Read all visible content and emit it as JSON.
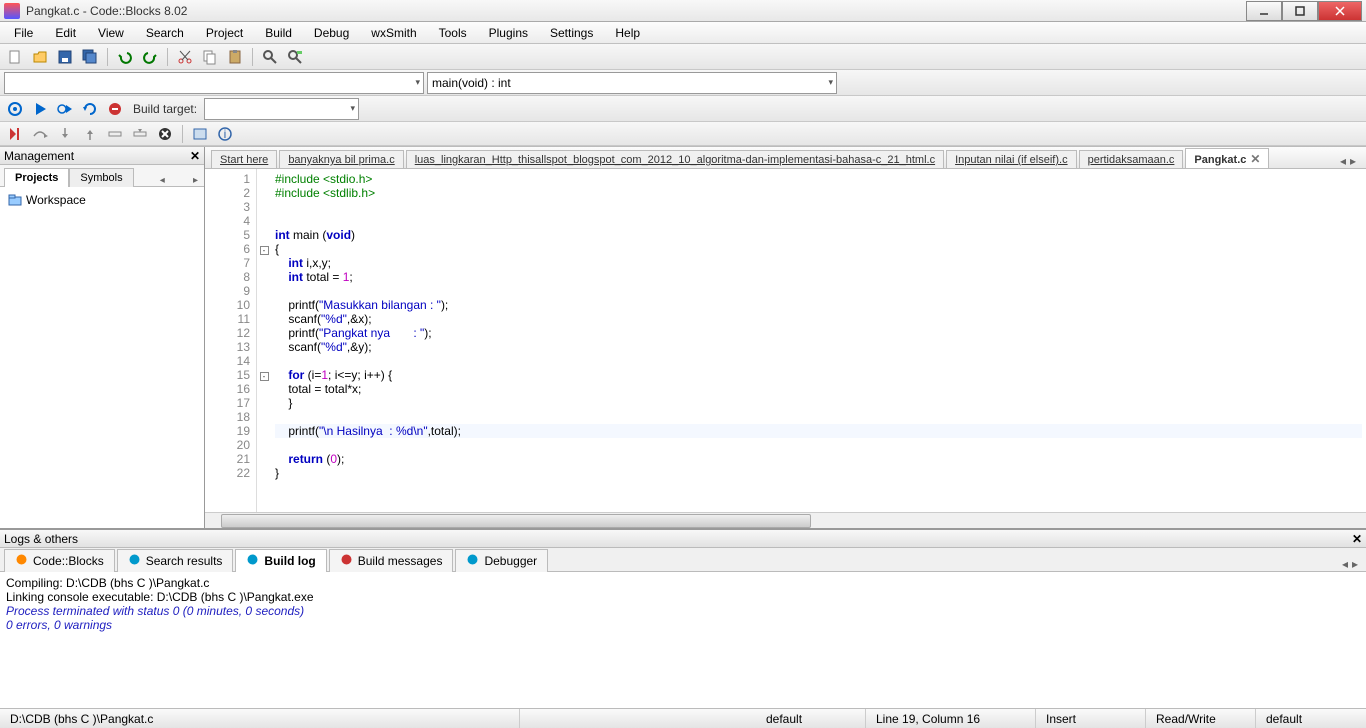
{
  "window": {
    "title": "Pangkat.c - Code::Blocks 8.02"
  },
  "menu": [
    "File",
    "Edit",
    "View",
    "Search",
    "Project",
    "Build",
    "Debug",
    "wxSmith",
    "Tools",
    "Plugins",
    "Settings",
    "Help"
  ],
  "combo_func": "main(void) : int",
  "build_target_label": "Build target:",
  "mgmt": {
    "title": "Management",
    "tabs": [
      "Projects",
      "Symbols"
    ],
    "active_tab": 0,
    "tree_root": "Workspace"
  },
  "editor": {
    "tabs": [
      {
        "label": "Start here",
        "active": false,
        "close": false
      },
      {
        "label": "banyaknya bil prima.c",
        "active": false,
        "close": false
      },
      {
        "label": "luas_lingkaran_Http_thisallspot_blogspot_com_2012_10_algoritma-dan-implementasi-bahasa-c_21_html.c",
        "active": false,
        "close": false
      },
      {
        "label": "Inputan nilai (if elseif).c",
        "active": false,
        "close": false
      },
      {
        "label": "pertidaksamaan.c",
        "active": false,
        "close": false
      },
      {
        "label": "Pangkat.c",
        "active": true,
        "close": true
      }
    ],
    "code": [
      {
        "n": 1,
        "fold": "",
        "html": "<span class='kw-pp'>#include &lt;stdio.h&gt;</span>"
      },
      {
        "n": 2,
        "fold": "",
        "html": "<span class='kw-pp'>#include &lt;stdlib.h&gt;</span>"
      },
      {
        "n": 3,
        "fold": "",
        "html": ""
      },
      {
        "n": 4,
        "fold": "",
        "html": ""
      },
      {
        "n": 5,
        "fold": "",
        "html": "<span class='kw'>int</span> main (<span class='kw'>void</span>)"
      },
      {
        "n": 6,
        "fold": "-",
        "html": "{"
      },
      {
        "n": 7,
        "fold": "",
        "html": "    <span class='kw'>int</span> i,x,y;"
      },
      {
        "n": 8,
        "fold": "",
        "html": "    <span class='kw'>int</span> total = <span class='num'>1</span>;"
      },
      {
        "n": 9,
        "fold": "",
        "html": ""
      },
      {
        "n": 10,
        "fold": "",
        "html": "    printf(<span class='str'>\"Masukkan bilangan : \"</span>);"
      },
      {
        "n": 11,
        "fold": "",
        "html": "    scanf(<span class='str'>\"%d\"</span>,&amp;x);"
      },
      {
        "n": 12,
        "fold": "",
        "html": "    printf(<span class='str'>\"Pangkat nya       : \"</span>);"
      },
      {
        "n": 13,
        "fold": "",
        "html": "    scanf(<span class='str'>\"%d\"</span>,&amp;y);"
      },
      {
        "n": 14,
        "fold": "",
        "html": ""
      },
      {
        "n": 15,
        "fold": "-",
        "html": "    <span class='kw'>for</span> (i=<span class='num'>1</span>; i&lt;=y; i++) {"
      },
      {
        "n": 16,
        "fold": "",
        "html": "    total = total*x;"
      },
      {
        "n": 17,
        "fold": "",
        "html": "    }"
      },
      {
        "n": 18,
        "fold": "",
        "html": ""
      },
      {
        "n": 19,
        "fold": "",
        "html": "    printf(<span class='str'>\"\\n Hasilnya  : %d\\n\"</span>,total);",
        "cursor": true
      },
      {
        "n": 20,
        "fold": "",
        "html": ""
      },
      {
        "n": 21,
        "fold": "",
        "html": "    <span class='kw'>return</span> (<span class='num'>0</span>);"
      },
      {
        "n": 22,
        "fold": "",
        "html": "}"
      }
    ]
  },
  "logs": {
    "title": "Logs & others",
    "tabs": [
      "Code::Blocks",
      "Search results",
      "Build log",
      "Build messages",
      "Debugger"
    ],
    "active": 2,
    "lines": [
      {
        "t": "Compiling: D:\\CDB (bhs C )\\Pangkat.c",
        "cls": ""
      },
      {
        "t": "Linking console executable: D:\\CDB (bhs C )\\Pangkat.exe",
        "cls": ""
      },
      {
        "t": "Process terminated with status 0 (0 minutes, 0 seconds)",
        "cls": "blue"
      },
      {
        "t": "0 errors, 0 warnings",
        "cls": "blue"
      }
    ]
  },
  "status": {
    "path": "D:\\CDB (bhs C )\\Pangkat.c",
    "enc": "default",
    "pos": "Line 19, Column 16",
    "ins": "Insert",
    "rw": "Read/Write",
    "eol": "default"
  }
}
